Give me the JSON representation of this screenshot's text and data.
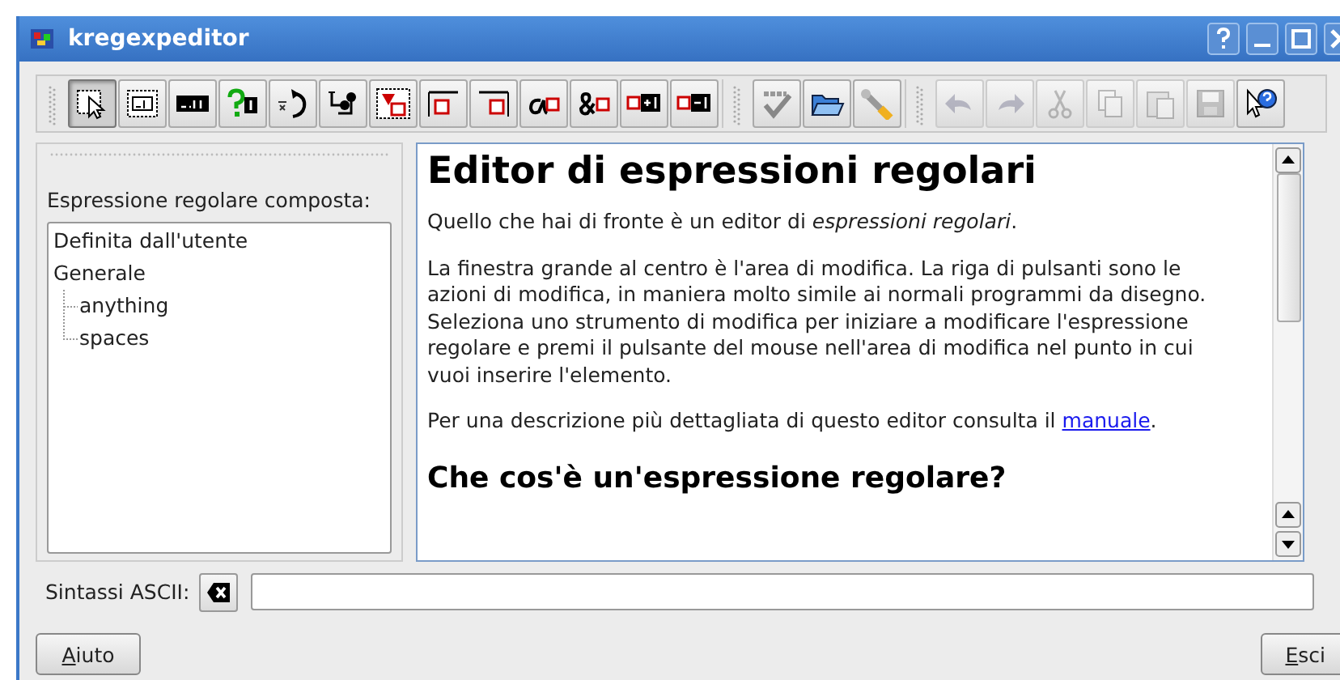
{
  "window": {
    "title": "kregexpeditor"
  },
  "toolbar": [
    [
      {
        "kind": "select",
        "selected": true,
        "disabled": false
      },
      {
        "kind": "text",
        "selected": false,
        "disabled": false
      },
      {
        "kind": "any-char",
        "selected": false,
        "disabled": false
      },
      {
        "kind": "optional",
        "selected": false,
        "disabled": false
      },
      {
        "kind": "repeat",
        "selected": false,
        "disabled": false
      },
      {
        "kind": "compound",
        "selected": false,
        "disabled": false
      },
      {
        "kind": "zone",
        "selected": false,
        "disabled": false
      },
      {
        "kind": "line-start",
        "selected": false,
        "disabled": false
      },
      {
        "kind": "line-end",
        "selected": false,
        "disabled": false
      },
      {
        "kind": "word-boundary",
        "selected": false,
        "disabled": false
      },
      {
        "kind": "and",
        "selected": false,
        "disabled": false
      },
      {
        "kind": "lookahead-positive",
        "selected": false,
        "disabled": false
      },
      {
        "kind": "lookahead-negative",
        "selected": false,
        "disabled": false
      }
    ],
    [
      {
        "kind": "spellcheck",
        "selected": false,
        "disabled": false
      },
      {
        "kind": "open",
        "selected": false,
        "disabled": false
      },
      {
        "kind": "wrench",
        "selected": false,
        "disabled": false
      }
    ],
    [
      {
        "kind": "undo",
        "selected": false,
        "disabled": true
      },
      {
        "kind": "redo",
        "selected": false,
        "disabled": true
      },
      {
        "kind": "cut",
        "selected": false,
        "disabled": true
      },
      {
        "kind": "copy",
        "selected": false,
        "disabled": true
      },
      {
        "kind": "paste",
        "selected": false,
        "disabled": true
      },
      {
        "kind": "save",
        "selected": false,
        "disabled": true
      },
      {
        "kind": "whats-this",
        "selected": false,
        "disabled": false
      }
    ]
  ],
  "compound_panel": {
    "label": "Espressione regolare composta:",
    "tree": [
      {
        "label": "Definita dall'utente"
      },
      {
        "label": "Generale",
        "children": [
          {
            "label": "anything"
          },
          {
            "label": "spaces"
          }
        ]
      }
    ]
  },
  "document": {
    "title": "Editor di espressioni regolari",
    "paragraphs": [
      {
        "text": "Quello che hai di fronte è un editor di *espressioni regolari*."
      },
      {
        "text": "La finestra grande al centro è l'area di modifica. La riga di pulsanti sono le azioni di modifica, in maniera molto simile ai normali programmi da disegno. Seleziona uno strumento di modifica per iniziare a modificare l'espressione regolare e premi il pulsante del mouse nell'area di modifica nel punto in cui vuoi inserire l'elemento."
      },
      {
        "text": "Per una descrizione più dettagliata di questo editor consulta il ",
        "link": "manuale",
        "after": "."
      }
    ],
    "subtitle": "Che cos'è un'espressione regolare?"
  },
  "ascii_syntax": {
    "label": "Sintassi ASCII:"
  },
  "buttons": [
    {
      "label": "Aiuto",
      "mnemonic": true
    },
    {
      "label": "Esci",
      "mnemonic": true
    }
  ]
}
